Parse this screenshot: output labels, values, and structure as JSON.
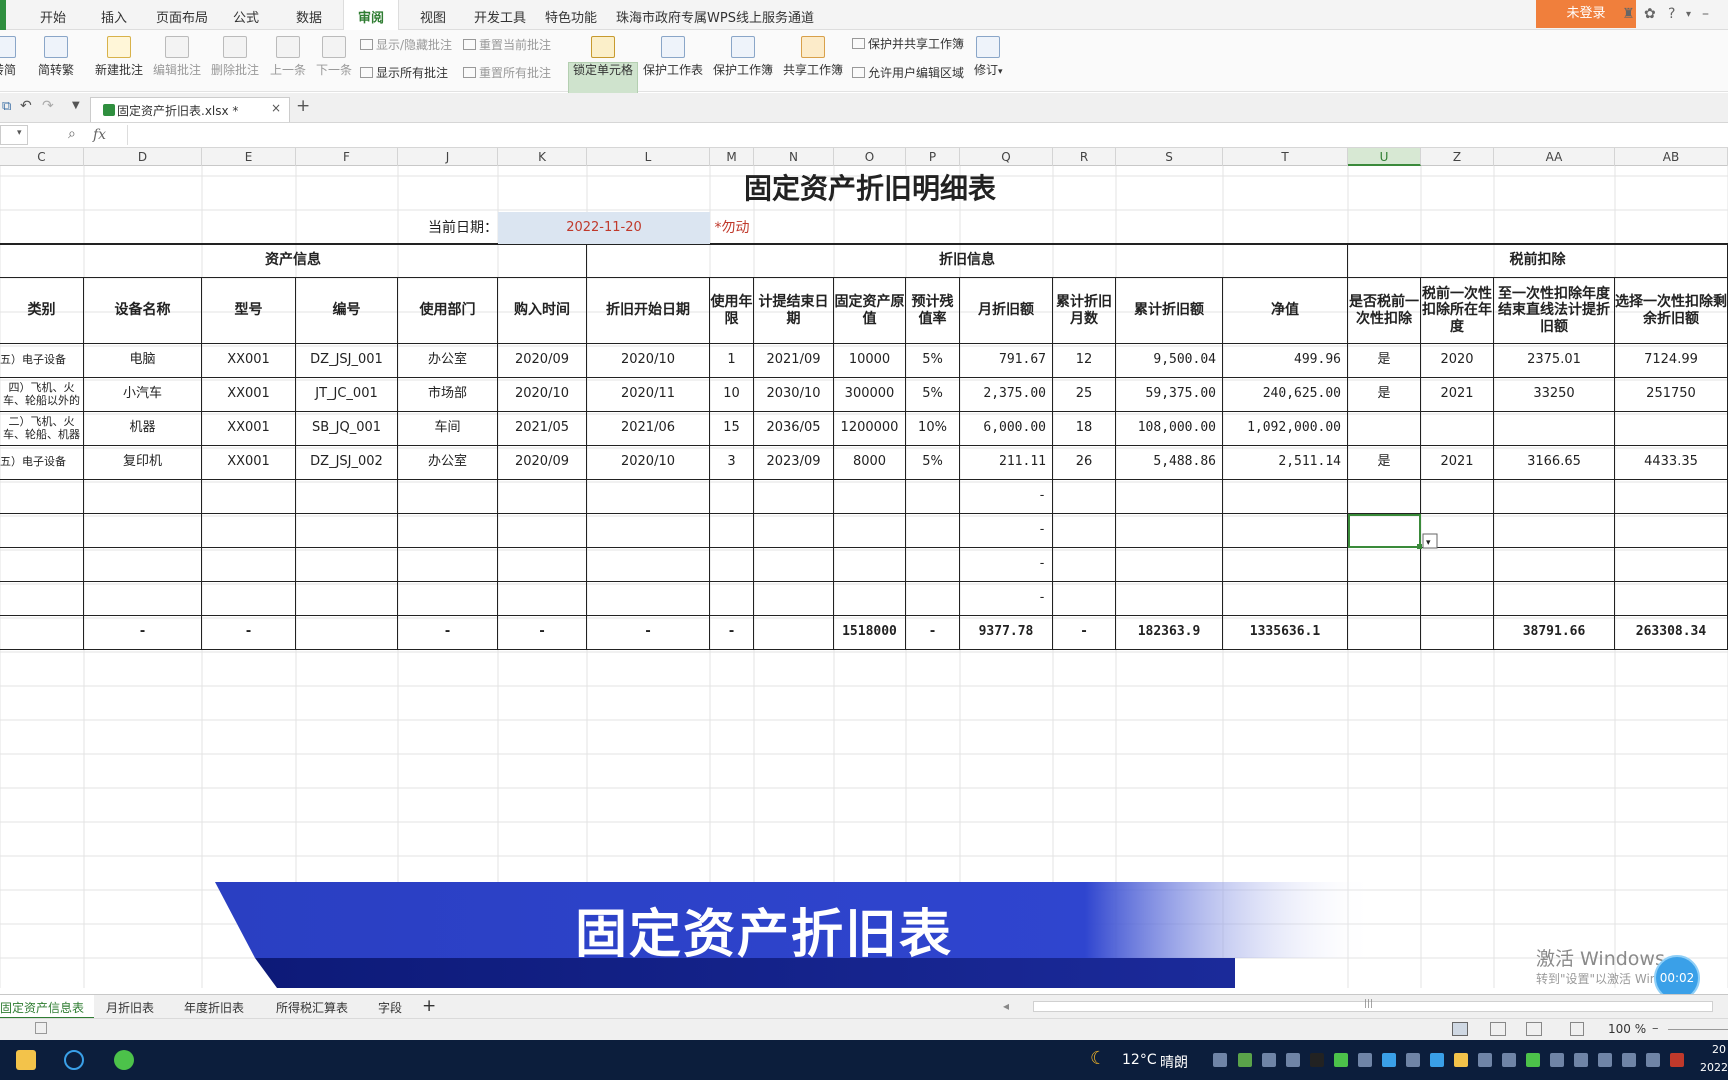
{
  "menu": {
    "items": [
      "开始",
      "插入",
      "页面布局",
      "公式",
      "数据",
      "审阅",
      "视图",
      "开发工具",
      "特色功能",
      "珠海市政府专属WPS线上服务通道"
    ],
    "active": "审阅",
    "login": "未登录"
  },
  "ribbon": {
    "to_simplified": "转简",
    "to_traditional": "简转繁",
    "new_comment": "新建批注",
    "edit_comment": "编辑批注",
    "delete_comment": "删除批注",
    "prev": "上一条",
    "next": "下一条",
    "show_hide_comment": "显示/隐藏批注",
    "reset_current_comment": "重置当前批注",
    "show_all_comments": "显示所有批注",
    "reset_all_comments": "重置所有批注",
    "lock_cell": "锁定单元格",
    "protect_sheet": "保护工作表",
    "protect_workbook": "保护工作簿",
    "share_workbook": "共享工作簿",
    "protect_and_share": "保护并共享工作簿",
    "allow_edit_ranges": "允许用户编辑区域",
    "track_changes": "修订"
  },
  "file_tab": {
    "name": "固定资产折旧表.xlsx *",
    "close": "×",
    "add": "+"
  },
  "formula_bar": {
    "fx": "fx",
    "value": ""
  },
  "columns": [
    "C",
    "D",
    "E",
    "F",
    "J",
    "K",
    "L",
    "M",
    "N",
    "O",
    "P",
    "Q",
    "R",
    "S",
    "T",
    "U",
    "Z",
    "AA",
    "AB"
  ],
  "selected_column": "U",
  "sheet": {
    "title": "固定资产折旧明细表",
    "date_label": "当前日期：",
    "date_value": "2022-11-20",
    "date_note": "*勿动",
    "groups": {
      "asset_info": "资产信息",
      "depreciation_info": "折旧信息",
      "pretax_deduction": "税前扣除"
    },
    "headers": [
      "类别",
      "设备名称",
      "型号",
      "编号",
      "使用部门",
      "购入时间",
      "折旧开始日期",
      "使用年限",
      "计提结束日期",
      "固定资产原值",
      "预计残值率",
      "月折旧额",
      "累计折旧月数",
      "累计折旧额",
      "净值",
      "是否税前一次性扣除",
      "税前一次性扣除所在年度",
      "至一次性扣除年度结束直线法计提折旧额",
      "选择一次性扣除剩余折旧额"
    ],
    "rows": [
      [
        "五）电子设备",
        "电脑",
        "XX001",
        "DZ_JSJ_001",
        "办公室",
        "2020/09",
        "2020/10",
        "1",
        "2021/09",
        "10000",
        "5%",
        "791.67",
        "12",
        "9,500.04",
        "499.96",
        "是",
        "2020",
        "2375.01",
        "7124.99"
      ],
      [
        "四）飞机、火车、轮船以外的",
        "小汽车",
        "XX001",
        "JT_JC_001",
        "市场部",
        "2020/10",
        "2020/11",
        "10",
        "2030/10",
        "300000",
        "5%",
        "2,375.00",
        "25",
        "59,375.00",
        "240,625.00",
        "是",
        "2021",
        "33250",
        "251750"
      ],
      [
        "二）飞机、火车、轮船、机器",
        "机器",
        "XX001",
        "SB_JQ_001",
        "车间",
        "2021/05",
        "2021/06",
        "15",
        "2036/05",
        "1200000",
        "10%",
        "6,000.00",
        "18",
        "108,000.00",
        "1,092,000.00",
        "",
        "",
        "",
        ""
      ],
      [
        "五）电子设备",
        "复印机",
        "XX001",
        "DZ_JSJ_002",
        "办公室",
        "2020/09",
        "2020/10",
        "3",
        "2023/09",
        "8000",
        "5%",
        "211.11",
        "26",
        "5,488.86",
        "2,511.14",
        "是",
        "2021",
        "3166.65",
        "4433.35"
      ],
      [
        "",
        "",
        "",
        "",
        "",
        "",
        "",
        "",
        "",
        "",
        "",
        "-",
        "",
        "",
        "",
        "",
        "",
        "",
        ""
      ],
      [
        "",
        "",
        "",
        "",
        "",
        "",
        "",
        "",
        "",
        "",
        "",
        "-",
        "",
        "",
        "",
        "",
        "",
        "",
        ""
      ],
      [
        "",
        "",
        "",
        "",
        "",
        "",
        "",
        "",
        "",
        "",
        "",
        "-",
        "",
        "",
        "",
        "",
        "",
        "",
        ""
      ],
      [
        "",
        "",
        "",
        "",
        "",
        "",
        "",
        "",
        "",
        "",
        "",
        "-",
        "",
        "",
        "",
        "",
        "",
        "",
        ""
      ]
    ],
    "totals": [
      "",
      "-",
      "-",
      "",
      "-",
      "-",
      "-",
      "-",
      "",
      "1518000",
      "-",
      "9377.78",
      "-",
      "182363.9",
      "1335636.1",
      "",
      "",
      "38791.66",
      "263308.34"
    ]
  },
  "overlay": {
    "banner_text": "固定资产折旧表",
    "watermark_line1": "激活 Windows",
    "watermark_line2": "转到\"设置\"以激活 Windows。",
    "timer": "00:02"
  },
  "sheet_tabs": {
    "items": [
      "固定资产信息表",
      "月折旧表",
      "年度折旧表",
      "所得税汇算表",
      "字段"
    ],
    "active": "固定资产信息表",
    "add": "+"
  },
  "statusbar": {
    "zoom": "100 %"
  },
  "taskbar": {
    "weather_temp": "12°C",
    "weather_desc": "晴朗",
    "clock_top": "20",
    "clock_bottom": "2022"
  },
  "colors": {
    "accent_green": "#2f7d32",
    "login_orange": "#f07f3c",
    "banner_blue": "#2b3fc4",
    "date_red": "#c0392b",
    "date_bg": "#dbe5f1"
  }
}
